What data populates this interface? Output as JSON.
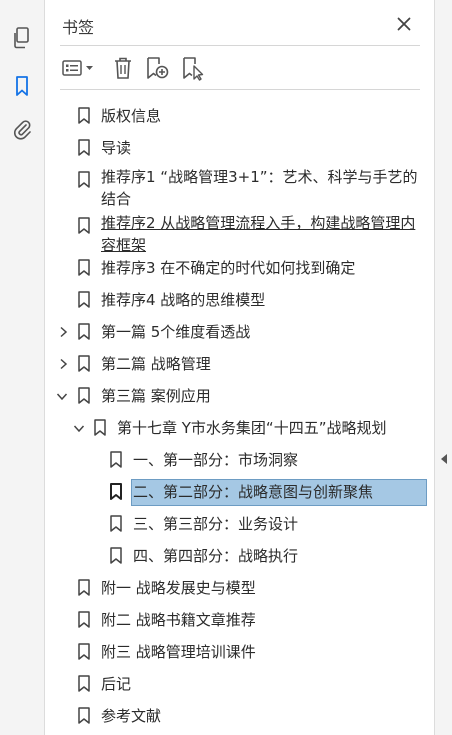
{
  "rail": {
    "pages_icon": "pages-icon",
    "bookmarks_icon": "bookmark-icon",
    "attachments_icon": "paperclip-icon"
  },
  "panel": {
    "title": "书签",
    "close_symbol": "✕"
  },
  "toolbar": {
    "options_icon": "list-options-icon",
    "delete_icon": "trash-icon",
    "new_bookmark_icon": "bookmark-add-icon",
    "bookmark_from_selection_icon": "bookmark-select-icon"
  },
  "colors": {
    "selection": "#a5c8e4",
    "accent": "#1473e6"
  },
  "bookmarks": [
    {
      "label": "版权信息"
    },
    {
      "label": "导读"
    },
    {
      "label": "推荐序1 “战略管理3+1”：艺术、科学与手艺的结合"
    },
    {
      "label": "推荐序2 从战略管理流程入手，构建战略管理内容框架"
    },
    {
      "label": "推荐序3 在不确定的时代如何找到确定"
    },
    {
      "label": "推荐序4 战略的思维模型"
    },
    {
      "label": "第一篇 5个维度看透战",
      "state": "collapsed"
    },
    {
      "label": "第二篇 战略管理",
      "state": "collapsed"
    },
    {
      "label": "第三篇 案例应用",
      "state": "expanded"
    },
    {
      "label": "第十七章 Y市水务集团“十四五”战略规划",
      "state": "expanded"
    },
    {
      "label": "一、第一部分：市场洞察"
    },
    {
      "label": "二、第二部分：战略意图与创新聚焦",
      "state": "selected"
    },
    {
      "label": "三、第三部分：业务设计"
    },
    {
      "label": "四、第四部分：战略执行"
    },
    {
      "label": "附一 战略发展史与模型"
    },
    {
      "label": "附二 战略书籍文章推荐"
    },
    {
      "label": "附三 战略管理培训课件"
    },
    {
      "label": "后记"
    },
    {
      "label": "参考文献"
    }
  ]
}
